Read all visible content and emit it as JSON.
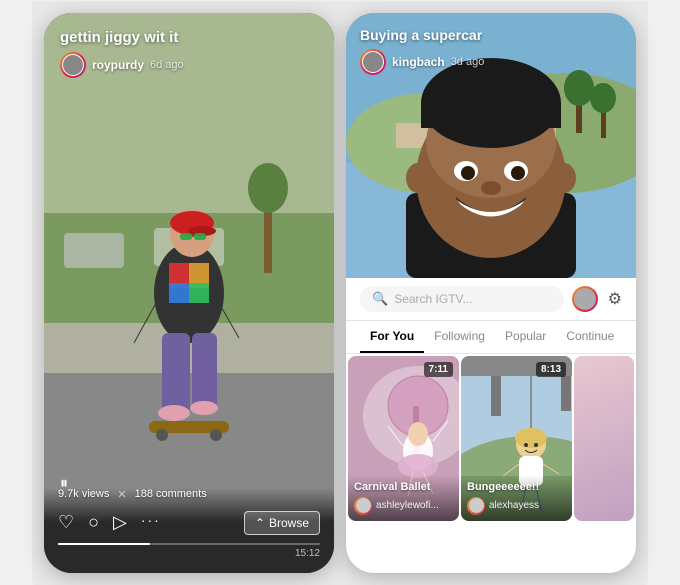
{
  "left_phone": {
    "title": "gettin jiggy wit it",
    "username": "roypurdy",
    "time_ago": "6d ago",
    "views": "9.7k views",
    "comments": "188 comments",
    "browse_label": "Browse",
    "browse_icon": "⌃",
    "duration": "15:12",
    "pause_icon": "⏸"
  },
  "right_phone": {
    "video_title": "Buying a supercar",
    "username": "kingbach",
    "time_ago": "3d ago",
    "search_placeholder": "Search IGTV...",
    "tabs": [
      {
        "label": "For You",
        "active": true
      },
      {
        "label": "Following",
        "active": false
      },
      {
        "label": "Popular",
        "active": false
      },
      {
        "label": "Continue",
        "active": false
      }
    ],
    "thumbnails": [
      {
        "title": "Carnival Ballet",
        "username": "ashleylewofi...",
        "duration": "7:11"
      },
      {
        "title": "Bungeeeeee!!",
        "username": "alexhayess",
        "duration": "8:13"
      }
    ]
  }
}
